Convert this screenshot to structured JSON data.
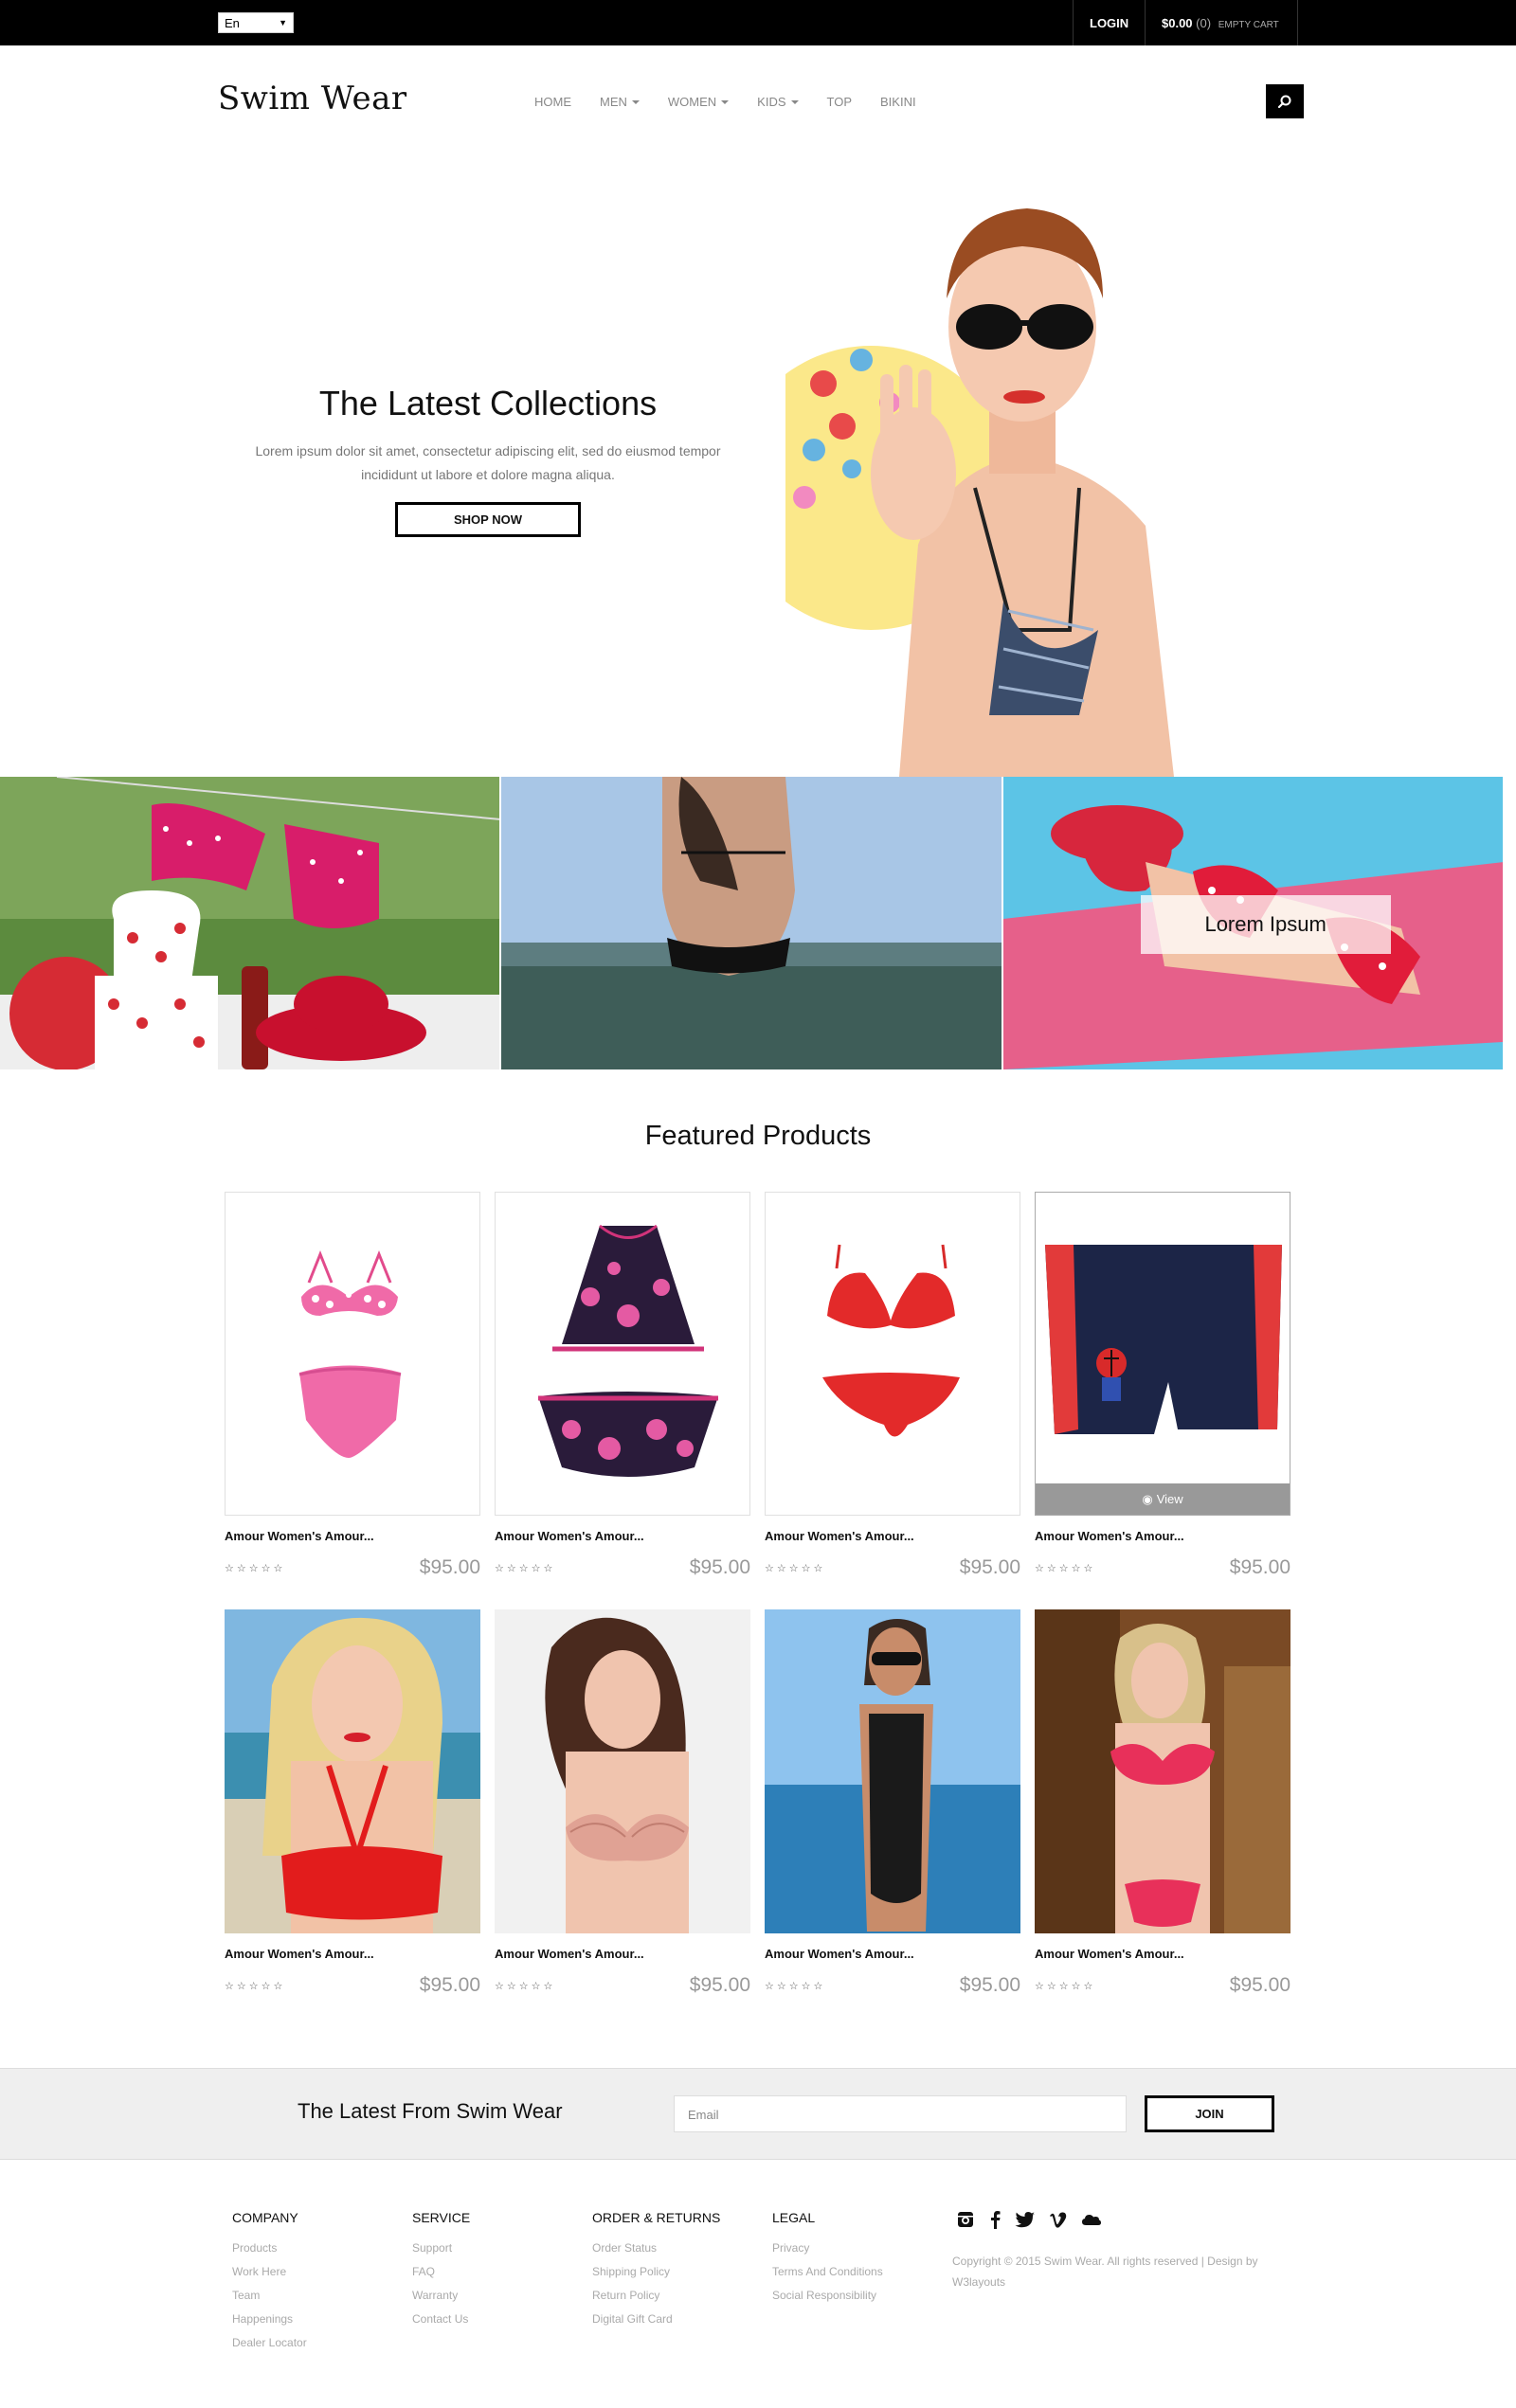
{
  "topbar": {
    "language": "En",
    "login": "LOGIN",
    "cart_amount": "$0.00",
    "cart_count": "(0)",
    "cart_empty": "EMPTY CART"
  },
  "header": {
    "logo": "Swim Wear",
    "nav": [
      {
        "label": "HOME",
        "dropdown": false
      },
      {
        "label": "MEN",
        "dropdown": true
      },
      {
        "label": "WOMEN",
        "dropdown": true
      },
      {
        "label": "KIDS",
        "dropdown": true
      },
      {
        "label": "TOP",
        "dropdown": false
      },
      {
        "label": "BIKINI",
        "dropdown": false
      }
    ],
    "search_icon": "search-icon"
  },
  "hero": {
    "title": "The Latest Collections",
    "text": "Lorem ipsum dolor sit amet, consectetur adipiscing elit, sed do eiusmod tempor incididunt ut labore et dolore magna aliqua.",
    "button": "SHOP NOW"
  },
  "banners": {
    "overlay_text": "Lorem Ipsum"
  },
  "featured": {
    "title": "Featured Products",
    "view_label": "View",
    "products": [
      {
        "name": "Amour Women's Amour...",
        "price": "$95.00",
        "rating": "☆☆☆☆☆"
      },
      {
        "name": "Amour Women's Amour...",
        "price": "$95.00",
        "rating": "☆☆☆☆☆"
      },
      {
        "name": "Amour Women's Amour...",
        "price": "$95.00",
        "rating": "☆☆☆☆☆"
      },
      {
        "name": "Amour Women's Amour...",
        "price": "$95.00",
        "rating": "☆☆☆☆☆"
      },
      {
        "name": "Amour Women's Amour...",
        "price": "$95.00",
        "rating": "☆☆☆☆☆"
      },
      {
        "name": "Amour Women's Amour...",
        "price": "$95.00",
        "rating": "☆☆☆☆☆"
      },
      {
        "name": "Amour Women's Amour...",
        "price": "$95.00",
        "rating": "☆☆☆☆☆"
      },
      {
        "name": "Amour Women's Amour...",
        "price": "$95.00",
        "rating": "☆☆☆☆☆"
      }
    ]
  },
  "newsletter": {
    "title": "The Latest From Swim Wear",
    "placeholder": "Email",
    "button": "JOIN"
  },
  "footer": {
    "columns": [
      {
        "title": "COMPANY",
        "links": [
          "Products",
          "Work Here",
          "Team",
          "Happenings",
          "Dealer Locator"
        ]
      },
      {
        "title": "SERVICE",
        "links": [
          "Support",
          "FAQ",
          "Warranty",
          "Contact Us"
        ]
      },
      {
        "title": "ORDER & RETURNS",
        "links": [
          "Order Status",
          "Shipping Policy",
          "Return Policy",
          "Digital Gift Card"
        ]
      },
      {
        "title": "LEGAL",
        "links": [
          "Privacy",
          "Terms And Conditions",
          "Social Responsibility"
        ]
      }
    ],
    "social_icons": [
      "instagram-icon",
      "facebook-icon",
      "twitter-icon",
      "vimeo-icon",
      "cloud-icon"
    ],
    "copyright": "Copyright © 2015 Swim Wear. All rights reserved | Design by  W3layouts"
  }
}
